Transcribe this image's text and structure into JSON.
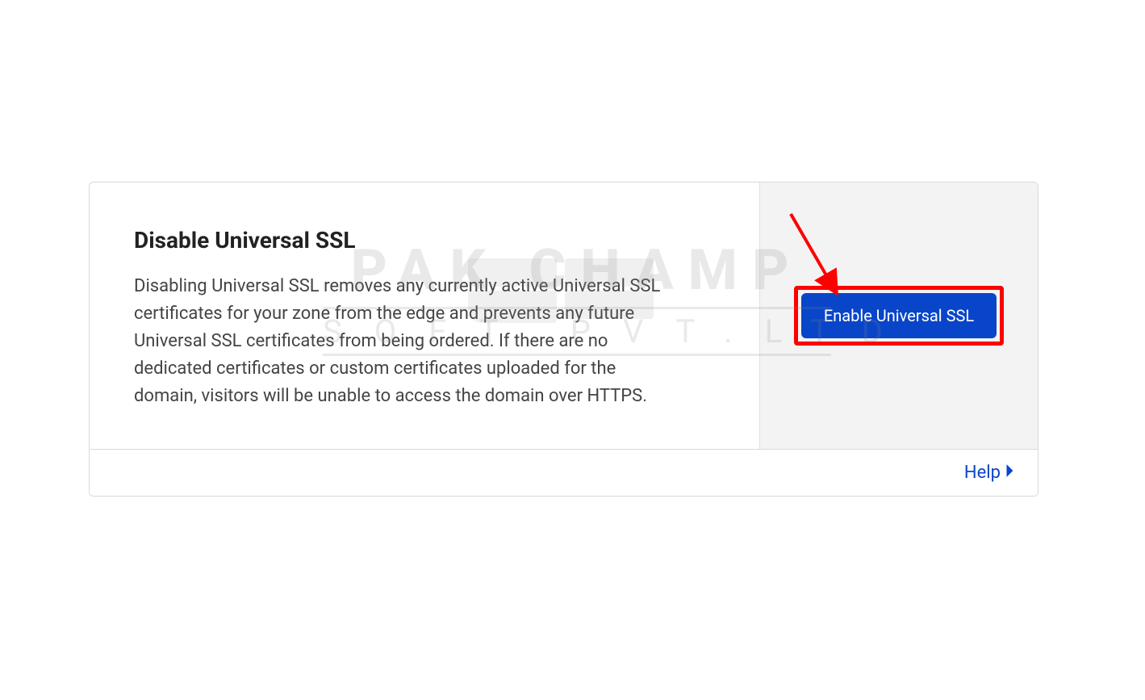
{
  "card": {
    "title": "Disable Universal SSL",
    "description": "Disabling Universal SSL removes any currently active Universal SSL certificates for your zone from the edge and prevents any future Universal SSL certificates from being ordered. If there are no dedicated certificates or custom certificates uploaded for the domain, visitors will be unable to access the domain over HTTPS.",
    "action_button": "Enable Universal SSL",
    "help_label": "Help"
  },
  "watermark": {
    "line1": "PAK CHAMP",
    "line2": "SOFT PVT.LTD"
  }
}
